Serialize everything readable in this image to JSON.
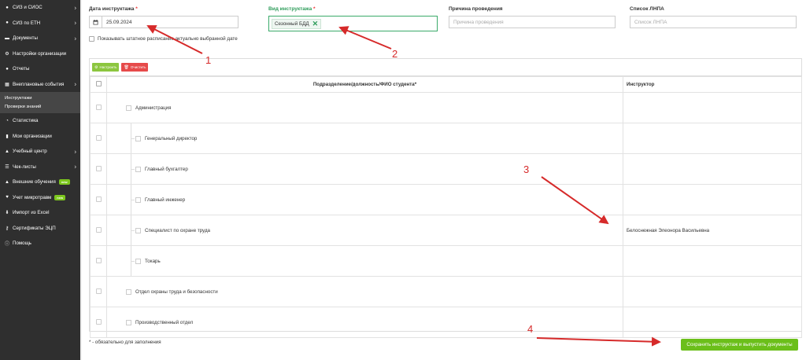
{
  "sidebar": {
    "items": [
      {
        "label": "СИЗ и СИОС",
        "icon": "dot-icon",
        "has_submenu": true
      },
      {
        "label": "СИЗ по ЕТН",
        "icon": "dot-icon",
        "has_submenu": true
      },
      {
        "label": "Документы",
        "icon": "folder-icon",
        "has_submenu": true
      },
      {
        "label": "Настройки организации",
        "icon": "gear-icon",
        "has_submenu": false
      },
      {
        "label": "Отчеты",
        "icon": "dot-icon",
        "has_submenu": false
      },
      {
        "label": "Внеплановые события",
        "icon": "calendar-icon",
        "has_submenu": true
      }
    ],
    "subitems": [
      {
        "label": "Инструктажи"
      },
      {
        "label": "Проверки знаний"
      }
    ],
    "items_after": [
      {
        "label": "Статистика",
        "icon": "chart-icon",
        "has_submenu": false
      },
      {
        "label": "Мои организации",
        "icon": "building-icon",
        "has_submenu": false
      },
      {
        "label": "Учебный центр",
        "icon": "graduation-cap-icon",
        "has_submenu": true
      },
      {
        "label": "Чек-листы",
        "icon": "checklist-icon",
        "has_submenu": true
      },
      {
        "label": "Внешние обучения",
        "icon": "graduation-cap-icon",
        "has_submenu": false,
        "badge": "new"
      },
      {
        "label": "Учет микротравм",
        "icon": "heart-icon",
        "has_submenu": false,
        "badge": "new"
      },
      {
        "label": "Импорт из Excel",
        "icon": "import-icon",
        "has_submenu": false
      },
      {
        "label": "Сертификаты ЭЦП",
        "icon": "key-icon",
        "has_submenu": false
      },
      {
        "label": "Помощь",
        "icon": "info-icon",
        "has_submenu": false
      }
    ]
  },
  "form": {
    "date_label": "Дата инструктажа",
    "date_value": "25.09.2024",
    "type_label": "Вид инструктажа",
    "type_tag": "Сезонный БДД",
    "reason_label": "Причина проведения",
    "reason_placeholder": "Причина проведения",
    "lnpa_label": "Список ЛНПА",
    "lnpa_placeholder": "Список ЛНПА",
    "required_mark": "*",
    "show_staff_label": "Показывать штатное расписание актуально выбранной дате"
  },
  "toolbar": {
    "configure_label": "Настроить",
    "clear_label": "Очистить"
  },
  "table": {
    "header_name": "Подразделение/должность/ФИО студента*",
    "header_instructor": "Инструктор",
    "rows": [
      {
        "name": "Администрация",
        "level": 0,
        "instructor": ""
      },
      {
        "name": "Генеральный директор",
        "level": 1,
        "instructor": ""
      },
      {
        "name": "Главный бухгалтер",
        "level": 1,
        "instructor": ""
      },
      {
        "name": "Главный инженер",
        "level": 1,
        "instructor": ""
      },
      {
        "name": "Специалист по охране труда",
        "level": 1,
        "instructor": "Белоснежная Элеонора Васильевна"
      },
      {
        "name": "Токарь",
        "level": 1,
        "instructor": ""
      },
      {
        "name": "Отдел охраны труда и безопасности",
        "level": 0,
        "instructor": ""
      },
      {
        "name": "Производственный отдел",
        "level": 0,
        "instructor": ""
      }
    ]
  },
  "footer": {
    "required_note": "* - обязательно для заполнения",
    "save_label": "Сохранить инструктаж и выпустить документы"
  },
  "annotations": {
    "numbers": [
      "1",
      "2",
      "3",
      "4"
    ],
    "color": "#d62a2a"
  },
  "colors": {
    "sidebar_bg": "#2f2f2f",
    "accent_green": "#6bbf1a",
    "required_red": "#e33333",
    "focus_green": "#3aaa6a"
  }
}
